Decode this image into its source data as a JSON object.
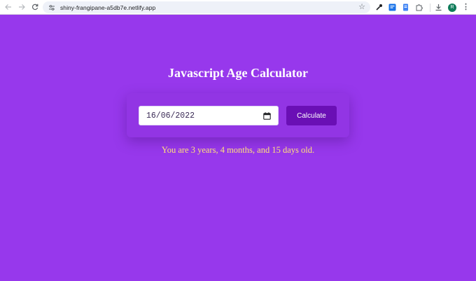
{
  "browser": {
    "url": "shiny-frangipane-a5db7e.netlify.app",
    "profile_initial": "R",
    "icons": {
      "back": "arrow-left-icon",
      "forward": "arrow-right-icon",
      "reload": "reload-icon",
      "site_info": "tune-icon",
      "bookmark": "star-icon",
      "extensions": [
        "eyedropper-icon",
        "translate-icon",
        "document-icon",
        "puzzle-icon"
      ],
      "downloads": "download-icon",
      "menu": "more-vert-icon"
    }
  },
  "page": {
    "title": "Javascript Age Calculator",
    "date_input": {
      "value": "16/06/2022"
    },
    "calculate_label": "Calculate",
    "result_text": "You are 3 years, 4 months, and 15 days old."
  },
  "colors": {
    "background": "#9738ec",
    "card": "#9235e4",
    "button": "#6a0fb5",
    "result_text": "#ffe17a",
    "title_text": "#ffffff"
  }
}
